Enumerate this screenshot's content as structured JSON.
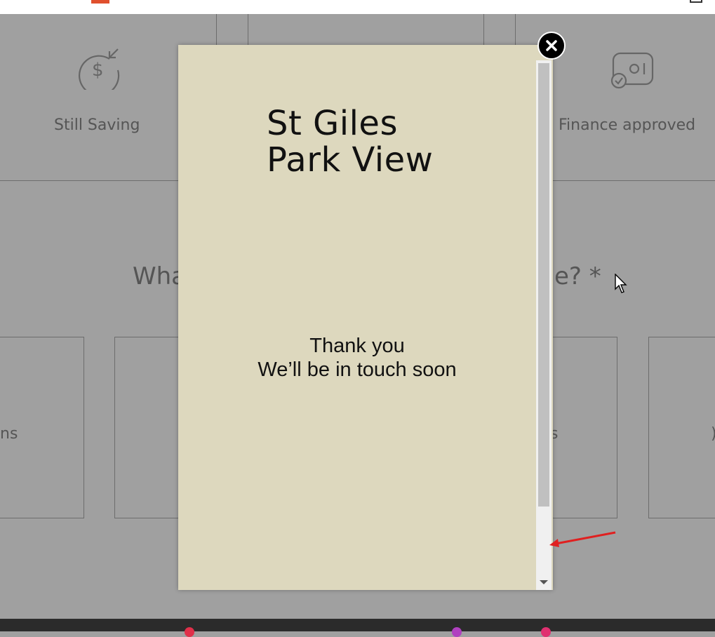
{
  "background": {
    "options": [
      {
        "label": "Still Saving",
        "icon": "dollar-arrow-icon"
      },
      {
        "label": "Finance approved",
        "icon": "check-card-icon"
      }
    ],
    "question_left": "Wha",
    "question_right": "e? *",
    "card_partial_left": "ns",
    "card_partial_right_a": "s",
    "card_partial_right_b": ")"
  },
  "modal": {
    "title_line1": "St Giles",
    "title_line2": "Park View",
    "thanks_line1": "Thank you",
    "thanks_line2": "We’ll be in touch soon"
  },
  "colors": {
    "overlay": "#a0a0a0",
    "modal_bg": "#ddd8be",
    "annotation": "#e02020"
  }
}
